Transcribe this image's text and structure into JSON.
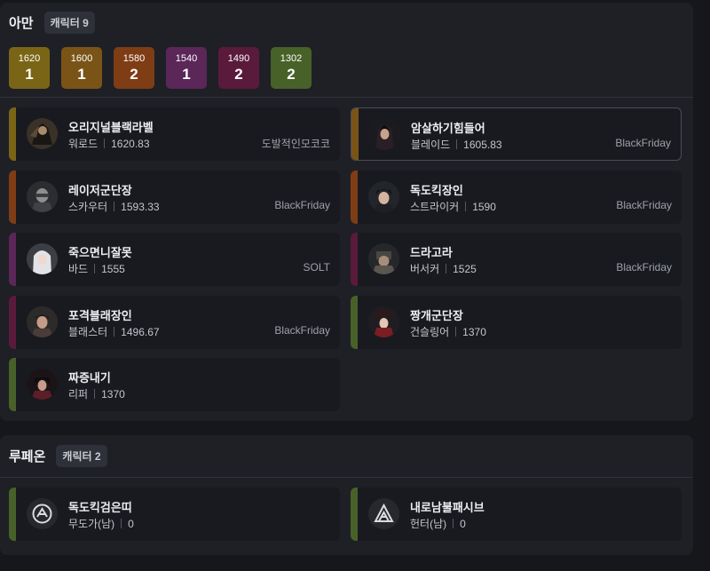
{
  "servers": [
    {
      "name": "아만",
      "count_label": "캐릭터 9",
      "levels": [
        {
          "level": "1620",
          "count": "1",
          "color": "#7a6516"
        },
        {
          "level": "1600",
          "count": "1",
          "color": "#7a5417"
        },
        {
          "level": "1580",
          "count": "2",
          "color": "#7e3d15"
        },
        {
          "level": "1540",
          "count": "1",
          "color": "#5b2658"
        },
        {
          "level": "1490",
          "count": "2",
          "color": "#5a1a3b"
        },
        {
          "level": "1302",
          "count": "2",
          "color": "#486129"
        }
      ],
      "characters": [
        {
          "name": "오리지널블랙라벨",
          "class": "워로드",
          "level": "1620.83",
          "guild": "도발적인모코코",
          "color": "#7a6516",
          "avatar": "warlord-portrait"
        },
        {
          "name": "암살하기힘들어",
          "class": "블레이드",
          "level": "1605.83",
          "guild": "BlackFriday",
          "color": "#7a5417",
          "avatar": "blade-portrait"
        },
        {
          "name": "레이저군단장",
          "class": "스카우터",
          "level": "1593.33",
          "guild": "BlackFriday",
          "color": "#7e3d15",
          "avatar": "scouter-portrait"
        },
        {
          "name": "독도킥장인",
          "class": "스트라이커",
          "level": "1590",
          "guild": "BlackFriday",
          "color": "#7e3d15",
          "avatar": "striker-portrait"
        },
        {
          "name": "죽으면니잘못",
          "class": "바드",
          "level": "1555",
          "guild": "SOLT",
          "color": "#5b2658",
          "avatar": "bard-portrait"
        },
        {
          "name": "드라고라",
          "class": "버서커",
          "level": "1525",
          "guild": "BlackFriday",
          "color": "#5a1a3b",
          "avatar": "berserker-portrait"
        },
        {
          "name": "포격블래장인",
          "class": "블래스터",
          "level": "1496.67",
          "guild": "BlackFriday",
          "color": "#5a1a3b",
          "avatar": "blaster-portrait"
        },
        {
          "name": "짱개군단장",
          "class": "건슬링어",
          "level": "1370",
          "guild": "",
          "color": "#486129",
          "avatar": "gunslinger-portrait"
        },
        {
          "name": "짜증내기",
          "class": "리퍼",
          "level": "1370",
          "guild": "",
          "color": "#486129",
          "avatar": "reaper-portrait"
        }
      ]
    },
    {
      "name": "루페온",
      "count_label": "캐릭터 2",
      "characters": [
        {
          "name": "독도킥검은띠",
          "class": "무도가(남)",
          "level": "0",
          "guild": "",
          "color": "#486129",
          "avatar": "martial-artist-emblem-icon"
        },
        {
          "name": "내로남불패시브",
          "class": "헌터(남)",
          "level": "0",
          "guild": "",
          "color": "#486129",
          "avatar": "hunter-emblem-icon"
        }
      ]
    }
  ]
}
